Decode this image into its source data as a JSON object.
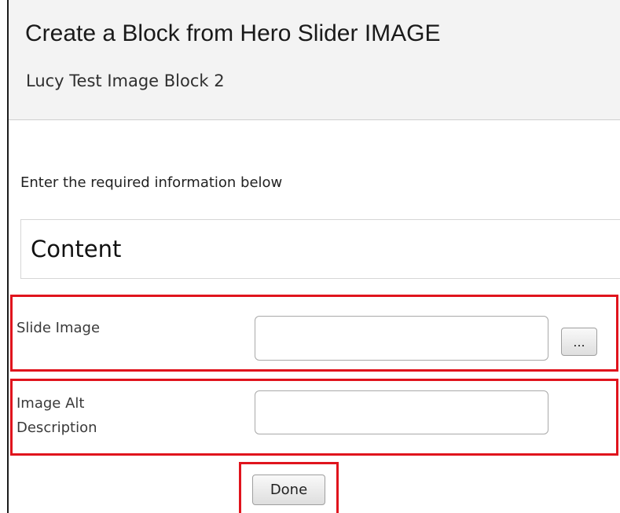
{
  "dialog": {
    "title": "Create a Block from Hero Slider IMAGE",
    "subtitle": "Lucy Test Image Block 2"
  },
  "form": {
    "instructions": "Enter the required information below",
    "section_title": "Content",
    "fields": [
      {
        "label": "Slide Image",
        "value": "",
        "browse_label": "..."
      },
      {
        "label_line1": "Image Alt",
        "label_line2": "Description",
        "value": ""
      }
    ]
  },
  "actions": {
    "done_label": "Done"
  },
  "colors": {
    "highlight": "#e0141d",
    "header_background": "#f3f3f3"
  }
}
